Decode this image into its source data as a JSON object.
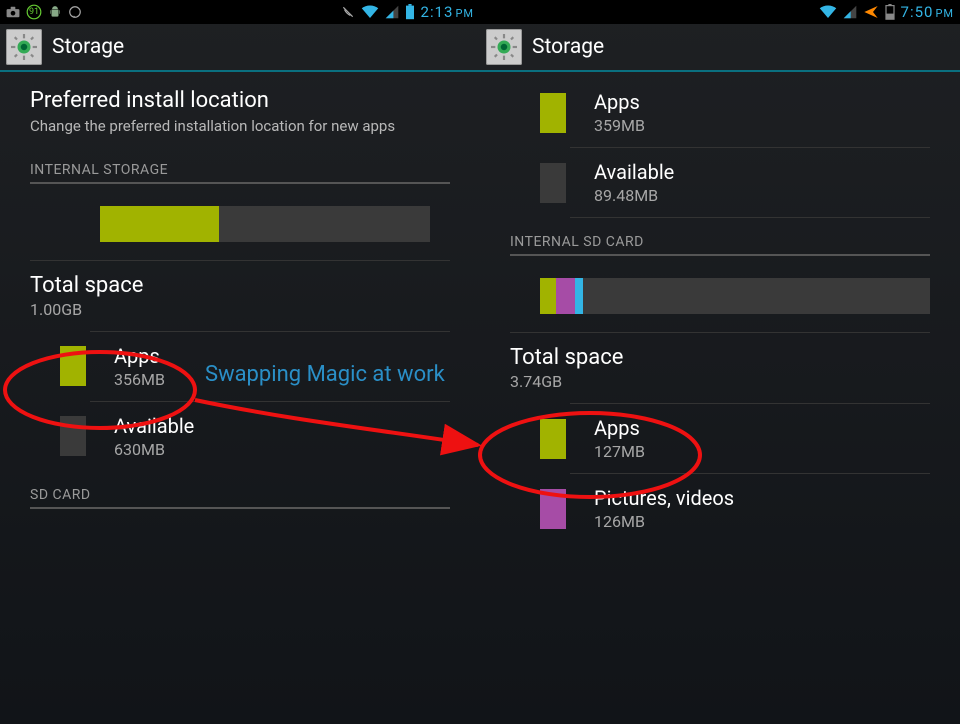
{
  "annotation": {
    "text": "Swapping Magic at work"
  },
  "left": {
    "status": {
      "time": "2:13",
      "ampm": "PM",
      "badge": "91"
    },
    "title": "Storage",
    "pref": {
      "title": "Preferred install location",
      "sub": "Change the preferred installation location for new apps"
    },
    "section1": "INTERNAL STORAGE",
    "bar": {
      "segments": [
        {
          "color": "#a1b300",
          "pct": 36
        }
      ]
    },
    "total": {
      "label": "Total space",
      "value": "1.00GB"
    },
    "rows": [
      {
        "label": "Apps",
        "value": "356MB",
        "color": "#a1b300"
      },
      {
        "label": "Available",
        "value": "630MB",
        "color": "#3a3a3a"
      }
    ],
    "section2": "SD CARD"
  },
  "right": {
    "status": {
      "time": "7:50",
      "ampm": "PM"
    },
    "title": "Storage",
    "rowsTop": [
      {
        "label": "Apps",
        "value": "359MB",
        "color": "#a1b300"
      },
      {
        "label": "Available",
        "value": "89.48MB",
        "color": "#3a3a3a"
      }
    ],
    "section1": "INTERNAL SD CARD",
    "bar": {
      "segments": [
        {
          "color": "#a1b300",
          "pct": 4
        },
        {
          "color": "#a64ca6",
          "pct": 5
        },
        {
          "color": "#33b5e5",
          "pct": 2
        }
      ]
    },
    "total": {
      "label": "Total space",
      "value": "3.74GB"
    },
    "rowsBottom": [
      {
        "label": "Apps",
        "value": "127MB",
        "color": "#a1b300"
      },
      {
        "label": "Pictures, videos",
        "value": "126MB",
        "color": "#a64ca6"
      }
    ]
  }
}
